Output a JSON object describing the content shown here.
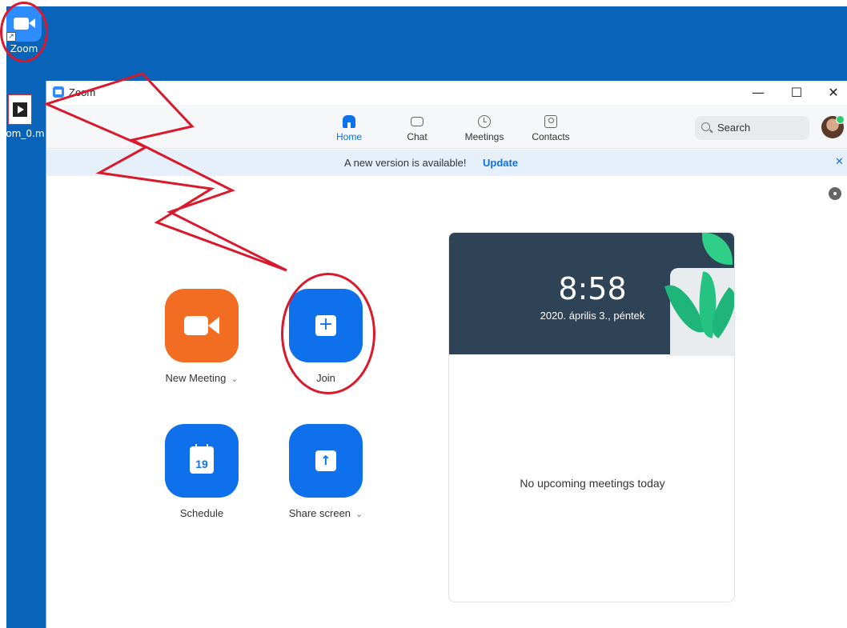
{
  "desktop": {
    "icons": [
      {
        "label": "Zoom"
      },
      {
        "label": "oom_0.m"
      }
    ]
  },
  "window": {
    "title": "Zoom",
    "controls": {
      "minimize": "—",
      "maximize": "☐",
      "close": "✕"
    }
  },
  "nav": {
    "tabs": [
      {
        "label": "Home",
        "icon": "home-icon",
        "active": true
      },
      {
        "label": "Chat",
        "icon": "chat-icon"
      },
      {
        "label": "Meetings",
        "icon": "clock-icon"
      },
      {
        "label": "Contacts",
        "icon": "contacts-icon"
      }
    ],
    "search_label": "Search"
  },
  "banner": {
    "message": "A new version is available!",
    "action": "Update",
    "close": "✕"
  },
  "actions": {
    "new_meeting": {
      "label": "New Meeting",
      "caret": "⌄",
      "color": "#f26d21"
    },
    "join": {
      "label": "Join",
      "icon_text": "+",
      "color": "#0e71eb"
    },
    "schedule": {
      "label": "Schedule",
      "icon_text": "19"
    },
    "share_screen": {
      "label": "Share screen",
      "caret": "⌄",
      "icon_text": "↑"
    }
  },
  "card": {
    "time": "8:58",
    "date": "2020. április 3., péntek",
    "empty_message": "No upcoming meetings today"
  },
  "colors": {
    "accent": "#0e71eb",
    "desktop": "#0863b9",
    "annotation": "#d9192c"
  }
}
